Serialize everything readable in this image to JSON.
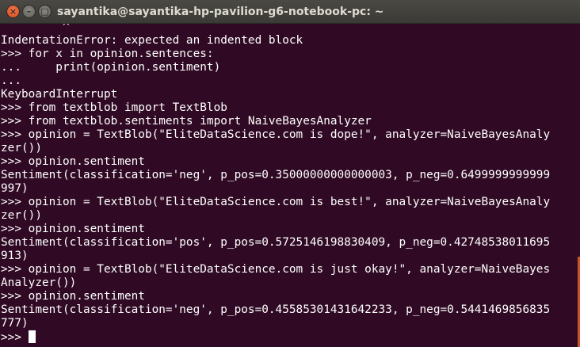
{
  "window": {
    "title": "sayantika@sayantika-hp-pavilion-g6-notebook-pc: ~",
    "controls": {
      "close_glyph": "×",
      "minimize_glyph": "–",
      "maximize_glyph": "□"
    },
    "colors": {
      "background": "#300a24",
      "text": "#ffffff",
      "titlebar": "#3c3b37",
      "close_button": "#e95420"
    }
  },
  "terminal": {
    "lines": [
      "         ^",
      "IndentationError: expected an indented block",
      ">>> for x in opinion.sentences:",
      "...     print(opinion.sentiment)",
      "...",
      "KeyboardInterrupt",
      ">>> from textblob import TextBlob",
      ">>> from textblob.sentiments import NaiveBayesAnalyzer",
      ">>> opinion = TextBlob(\"EliteDataScience.com is dope!\", analyzer=NaiveBayesAnaly",
      "zer())",
      ">>> opinion.sentiment",
      "Sentiment(classification='neg', p_pos=0.35000000000000003, p_neg=0.6499999999999",
      "997)",
      ">>> opinion = TextBlob(\"EliteDataScience.com is best!\", analyzer=NaiveBayesAnaly",
      "zer())",
      ">>> opinion.sentiment",
      "Sentiment(classification='pos', p_pos=0.5725146198830409, p_neg=0.42748538011695",
      "913)",
      ">>> opinion = TextBlob(\"EliteDataScience.com is just okay!\", analyzer=NaiveBayes",
      "Analyzer())",
      ">>> opinion.sentiment",
      "Sentiment(classification='neg', p_pos=0.45585301431642233, p_neg=0.5441469856835",
      "777)"
    ],
    "prompt": ">>> "
  }
}
